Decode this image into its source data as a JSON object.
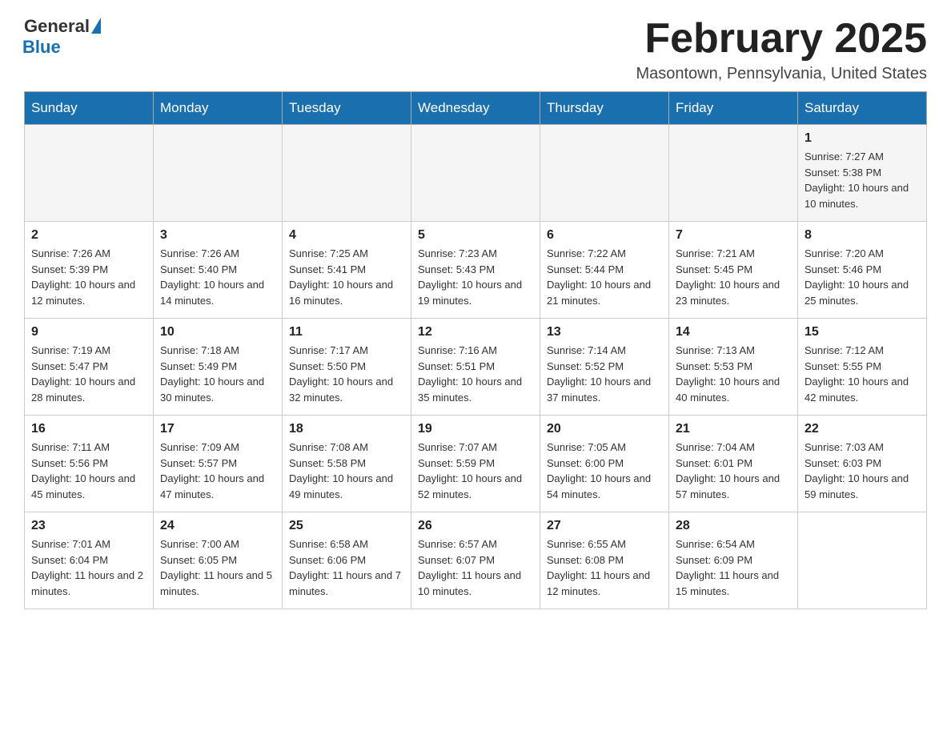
{
  "logo": {
    "general_text": "General",
    "blue_text": "Blue"
  },
  "header": {
    "month_year": "February 2025",
    "location": "Masontown, Pennsylvania, United States"
  },
  "days_of_week": [
    "Sunday",
    "Monday",
    "Tuesday",
    "Wednesday",
    "Thursday",
    "Friday",
    "Saturday"
  ],
  "weeks": [
    {
      "days": [
        {
          "number": "",
          "info": ""
        },
        {
          "number": "",
          "info": ""
        },
        {
          "number": "",
          "info": ""
        },
        {
          "number": "",
          "info": ""
        },
        {
          "number": "",
          "info": ""
        },
        {
          "number": "",
          "info": ""
        },
        {
          "number": "1",
          "info": "Sunrise: 7:27 AM\nSunset: 5:38 PM\nDaylight: 10 hours and 10 minutes."
        }
      ]
    },
    {
      "days": [
        {
          "number": "2",
          "info": "Sunrise: 7:26 AM\nSunset: 5:39 PM\nDaylight: 10 hours and 12 minutes."
        },
        {
          "number": "3",
          "info": "Sunrise: 7:26 AM\nSunset: 5:40 PM\nDaylight: 10 hours and 14 minutes."
        },
        {
          "number": "4",
          "info": "Sunrise: 7:25 AM\nSunset: 5:41 PM\nDaylight: 10 hours and 16 minutes."
        },
        {
          "number": "5",
          "info": "Sunrise: 7:23 AM\nSunset: 5:43 PM\nDaylight: 10 hours and 19 minutes."
        },
        {
          "number": "6",
          "info": "Sunrise: 7:22 AM\nSunset: 5:44 PM\nDaylight: 10 hours and 21 minutes."
        },
        {
          "number": "7",
          "info": "Sunrise: 7:21 AM\nSunset: 5:45 PM\nDaylight: 10 hours and 23 minutes."
        },
        {
          "number": "8",
          "info": "Sunrise: 7:20 AM\nSunset: 5:46 PM\nDaylight: 10 hours and 25 minutes."
        }
      ]
    },
    {
      "days": [
        {
          "number": "9",
          "info": "Sunrise: 7:19 AM\nSunset: 5:47 PM\nDaylight: 10 hours and 28 minutes."
        },
        {
          "number": "10",
          "info": "Sunrise: 7:18 AM\nSunset: 5:49 PM\nDaylight: 10 hours and 30 minutes."
        },
        {
          "number": "11",
          "info": "Sunrise: 7:17 AM\nSunset: 5:50 PM\nDaylight: 10 hours and 32 minutes."
        },
        {
          "number": "12",
          "info": "Sunrise: 7:16 AM\nSunset: 5:51 PM\nDaylight: 10 hours and 35 minutes."
        },
        {
          "number": "13",
          "info": "Sunrise: 7:14 AM\nSunset: 5:52 PM\nDaylight: 10 hours and 37 minutes."
        },
        {
          "number": "14",
          "info": "Sunrise: 7:13 AM\nSunset: 5:53 PM\nDaylight: 10 hours and 40 minutes."
        },
        {
          "number": "15",
          "info": "Sunrise: 7:12 AM\nSunset: 5:55 PM\nDaylight: 10 hours and 42 minutes."
        }
      ]
    },
    {
      "days": [
        {
          "number": "16",
          "info": "Sunrise: 7:11 AM\nSunset: 5:56 PM\nDaylight: 10 hours and 45 minutes."
        },
        {
          "number": "17",
          "info": "Sunrise: 7:09 AM\nSunset: 5:57 PM\nDaylight: 10 hours and 47 minutes."
        },
        {
          "number": "18",
          "info": "Sunrise: 7:08 AM\nSunset: 5:58 PM\nDaylight: 10 hours and 49 minutes."
        },
        {
          "number": "19",
          "info": "Sunrise: 7:07 AM\nSunset: 5:59 PM\nDaylight: 10 hours and 52 minutes."
        },
        {
          "number": "20",
          "info": "Sunrise: 7:05 AM\nSunset: 6:00 PM\nDaylight: 10 hours and 54 minutes."
        },
        {
          "number": "21",
          "info": "Sunrise: 7:04 AM\nSunset: 6:01 PM\nDaylight: 10 hours and 57 minutes."
        },
        {
          "number": "22",
          "info": "Sunrise: 7:03 AM\nSunset: 6:03 PM\nDaylight: 10 hours and 59 minutes."
        }
      ]
    },
    {
      "days": [
        {
          "number": "23",
          "info": "Sunrise: 7:01 AM\nSunset: 6:04 PM\nDaylight: 11 hours and 2 minutes."
        },
        {
          "number": "24",
          "info": "Sunrise: 7:00 AM\nSunset: 6:05 PM\nDaylight: 11 hours and 5 minutes."
        },
        {
          "number": "25",
          "info": "Sunrise: 6:58 AM\nSunset: 6:06 PM\nDaylight: 11 hours and 7 minutes."
        },
        {
          "number": "26",
          "info": "Sunrise: 6:57 AM\nSunset: 6:07 PM\nDaylight: 11 hours and 10 minutes."
        },
        {
          "number": "27",
          "info": "Sunrise: 6:55 AM\nSunset: 6:08 PM\nDaylight: 11 hours and 12 minutes."
        },
        {
          "number": "28",
          "info": "Sunrise: 6:54 AM\nSunset: 6:09 PM\nDaylight: 11 hours and 15 minutes."
        },
        {
          "number": "",
          "info": ""
        }
      ]
    }
  ]
}
